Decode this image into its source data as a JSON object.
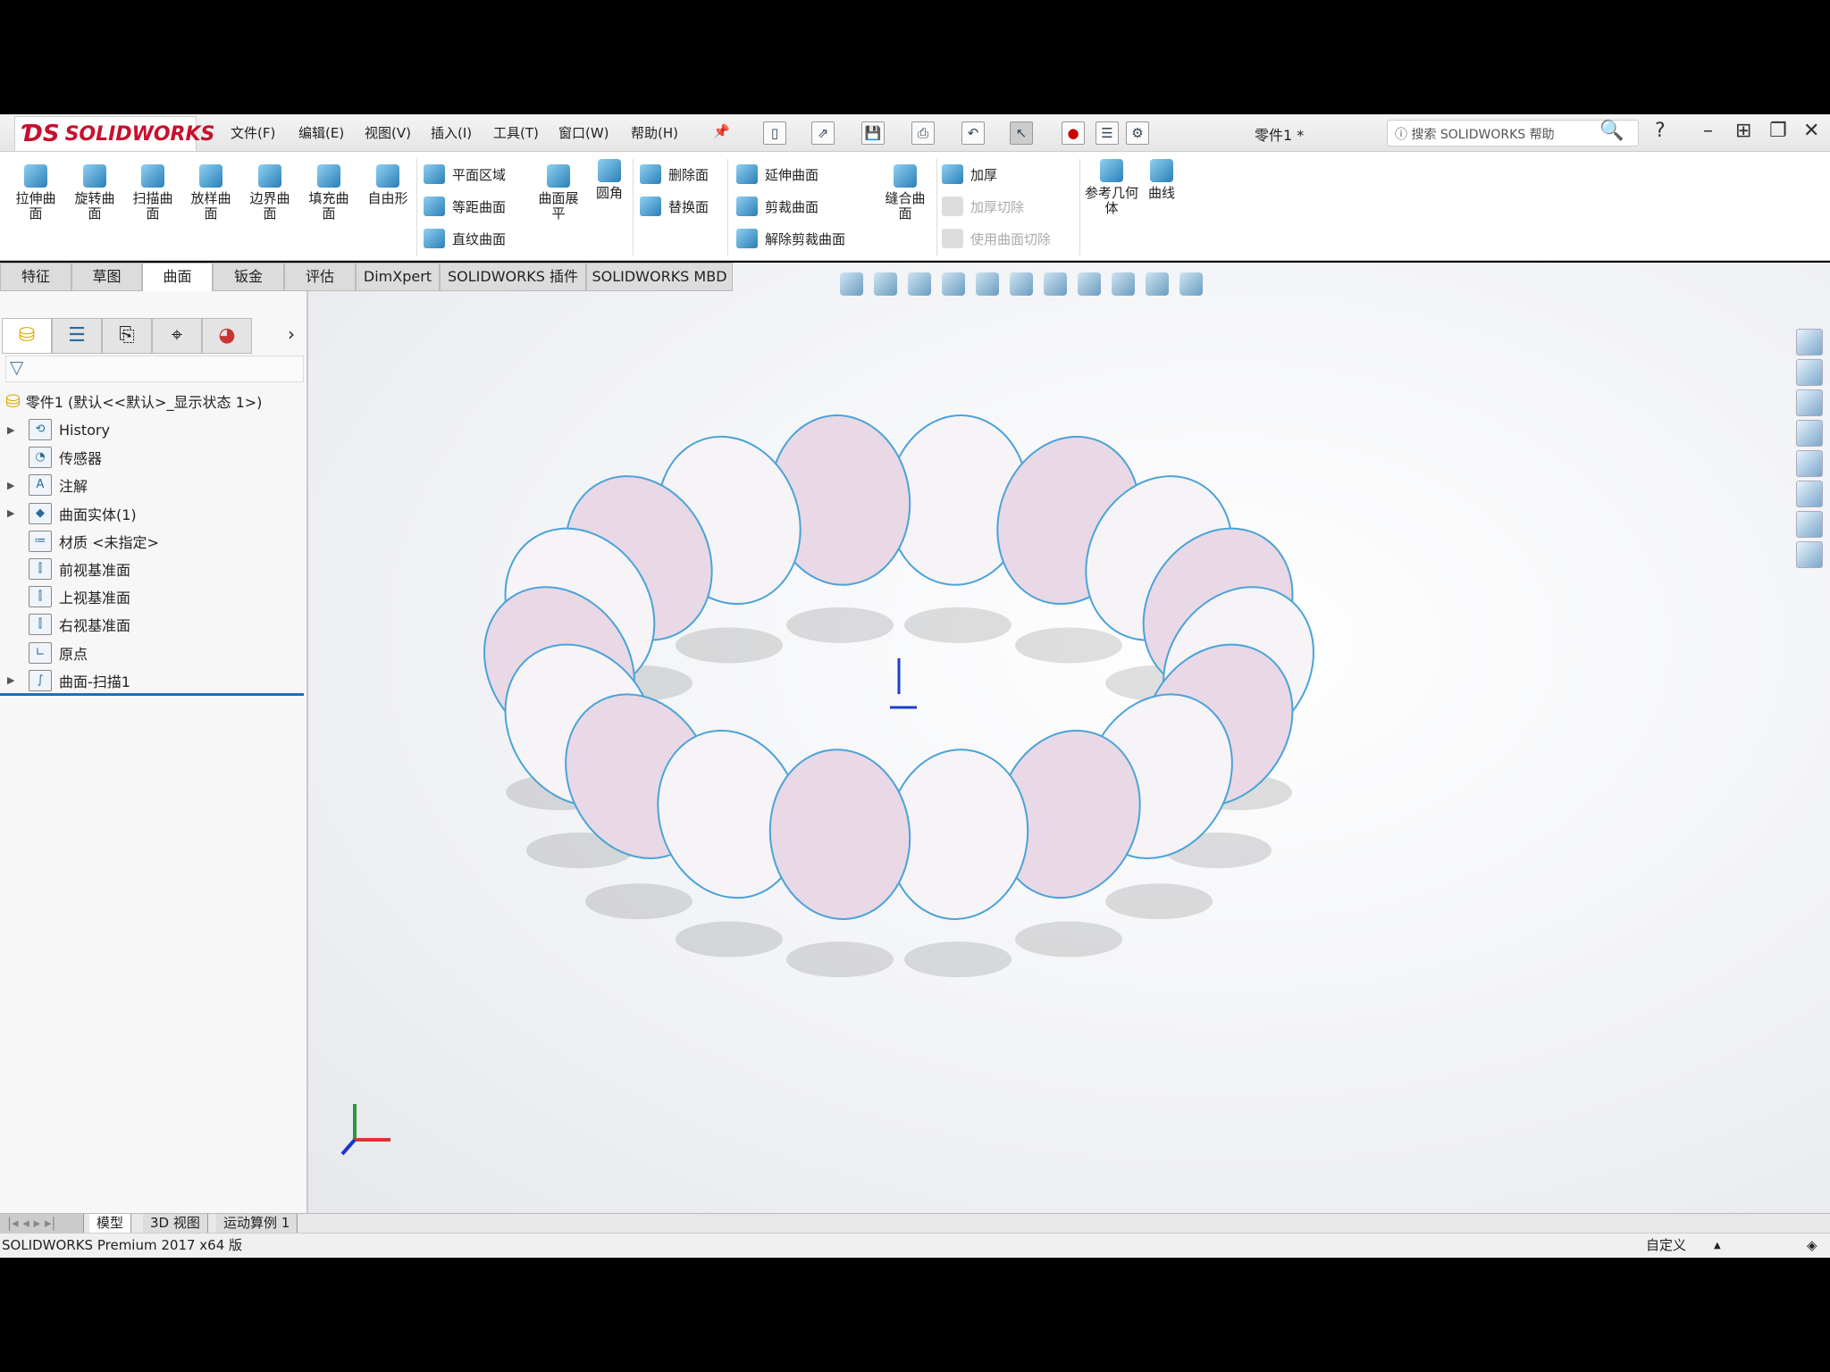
{
  "app": {
    "logo": "SOLIDWORKS",
    "doc_title": "零件1 *",
    "search_placeholder": "搜索 SOLIDWORKS 帮助"
  },
  "menu": [
    "文件(F)",
    "编辑(E)",
    "视图(V)",
    "插入(I)",
    "工具(T)",
    "窗口(W)",
    "帮助(H)"
  ],
  "ribbon": {
    "large": [
      "拉伸曲面",
      "旋转曲面",
      "扫描曲面",
      "放样曲面",
      "边界曲面",
      "填充曲面",
      "自由形"
    ],
    "col1": [
      "平面区域",
      "等距曲面",
      "直纹曲面"
    ],
    "flatten": "曲面展平",
    "fillet": "圆角",
    "col2": [
      "删除面",
      "替换面"
    ],
    "col3": [
      "延伸曲面",
      "剪裁曲面",
      "解除剪裁曲面"
    ],
    "knit": "缝合曲面",
    "col4": [
      "加厚",
      "加厚切除",
      "使用曲面切除"
    ],
    "refgeom": "参考几何体",
    "curves": "曲线"
  },
  "tabs": [
    "特征",
    "草图",
    "曲面",
    "钣金",
    "评估",
    "DimXpert",
    "SOLIDWORKS 插件",
    "SOLIDWORKS MBD"
  ],
  "active_tab": "曲面",
  "tree": {
    "root": "零件1  (默认<<默认>_显示状态 1>)",
    "items": [
      {
        "label": "History",
        "expandable": true,
        "icon": "history-icon"
      },
      {
        "label": "传感器",
        "expandable": false,
        "icon": "sensor-icon"
      },
      {
        "label": "注解",
        "expandable": true,
        "icon": "annotation-icon"
      },
      {
        "label": "曲面实体(1)",
        "expandable": true,
        "icon": "surface-body-icon"
      },
      {
        "label": "材质 <未指定>",
        "expandable": false,
        "icon": "material-icon"
      },
      {
        "label": "前视基准面",
        "expandable": false,
        "icon": "plane-icon"
      },
      {
        "label": "上视基准面",
        "expandable": false,
        "icon": "plane-icon"
      },
      {
        "label": "右视基准面",
        "expandable": false,
        "icon": "plane-icon"
      },
      {
        "label": "原点",
        "expandable": false,
        "icon": "origin-icon"
      },
      {
        "label": "曲面-扫描1",
        "expandable": true,
        "icon": "sweep-icon"
      }
    ]
  },
  "bottom_tabs": [
    "模型",
    "3D 视图",
    "运动算例 1"
  ],
  "status": {
    "left": "SOLIDWORKS Premium 2017 x64 版",
    "units": "自定义"
  },
  "colors": {
    "accent": "#1f6fb5",
    "surface_edge": "#4aa3d8",
    "surface_fill": "#e9d8e6"
  }
}
